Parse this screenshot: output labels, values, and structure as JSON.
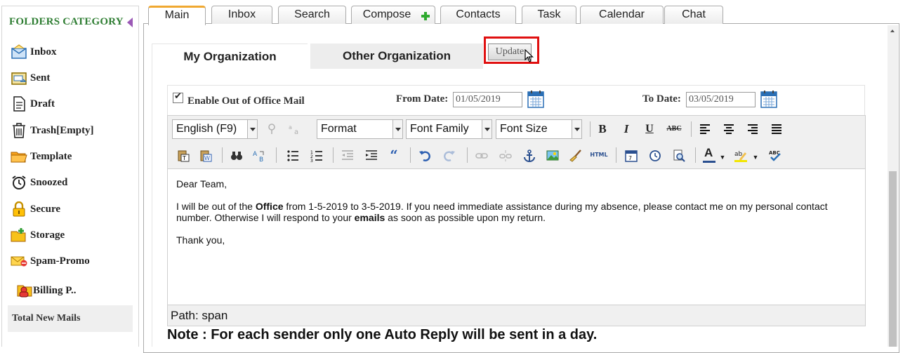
{
  "sidebar": {
    "header": "FOLDERS CATEGORY",
    "items": [
      {
        "label": "Inbox",
        "icon": "inbox-icon"
      },
      {
        "label": "Sent",
        "icon": "sent-icon"
      },
      {
        "label": "Draft",
        "icon": "draft-icon"
      },
      {
        "label": "Trash[Empty]",
        "icon": "trash-icon"
      },
      {
        "label": "Template",
        "icon": "template-folder-icon"
      },
      {
        "label": "Snoozed",
        "icon": "alarm-clock-icon"
      },
      {
        "label": "Secure",
        "icon": "lock-icon"
      },
      {
        "label": "Storage",
        "icon": "storage-folder-icon"
      },
      {
        "label": "Spam-Promo",
        "icon": "spam-icon"
      },
      {
        "label": "Billing P..",
        "icon": "billing-icon"
      }
    ],
    "total_new_mails": "Total New Mails"
  },
  "tabs": [
    "Main",
    "Inbox",
    "Search",
    "Compose",
    "Contacts",
    "Task",
    "Calendar",
    "Chat"
  ],
  "active_tab": "Main",
  "org_tabs": {
    "my": "My Organization",
    "other": "Other Organization"
  },
  "update_button": "Update",
  "options": {
    "enable_label": "Enable Out of Office Mail",
    "enabled": true,
    "from_label": "From Date:",
    "from_value": "01/05/2019",
    "to_label": "To Date:",
    "to_value": "03/05/2019"
  },
  "toolbar": {
    "language": "English (F9)",
    "format": "Format",
    "font_family": "Font Family",
    "font_size": "Font Size",
    "bold": "B",
    "italic": "I",
    "underline": "U",
    "strike": "ABC",
    "html": "HTML"
  },
  "message": {
    "greeting": "Dear Team,",
    "p1_a": "I will be out of the ",
    "p1_b": "Office",
    "p1_c": " from 1-5-2019 to 3-5-2019. If you need immediate assistance during my absence, please contact me on my personal contact number. Otherwise I will respond to your ",
    "p1_d": "emails",
    "p1_e": " as soon as possible upon my return.",
    "closing": "Thank you,"
  },
  "path": "Path: span",
  "note": "Note : For each sender only one Auto Reply will be sent in a day.",
  "colors": {
    "active_tab_accent": "#f0a830",
    "highlight_box": "#e01010",
    "header_green": "#2e7d32"
  }
}
